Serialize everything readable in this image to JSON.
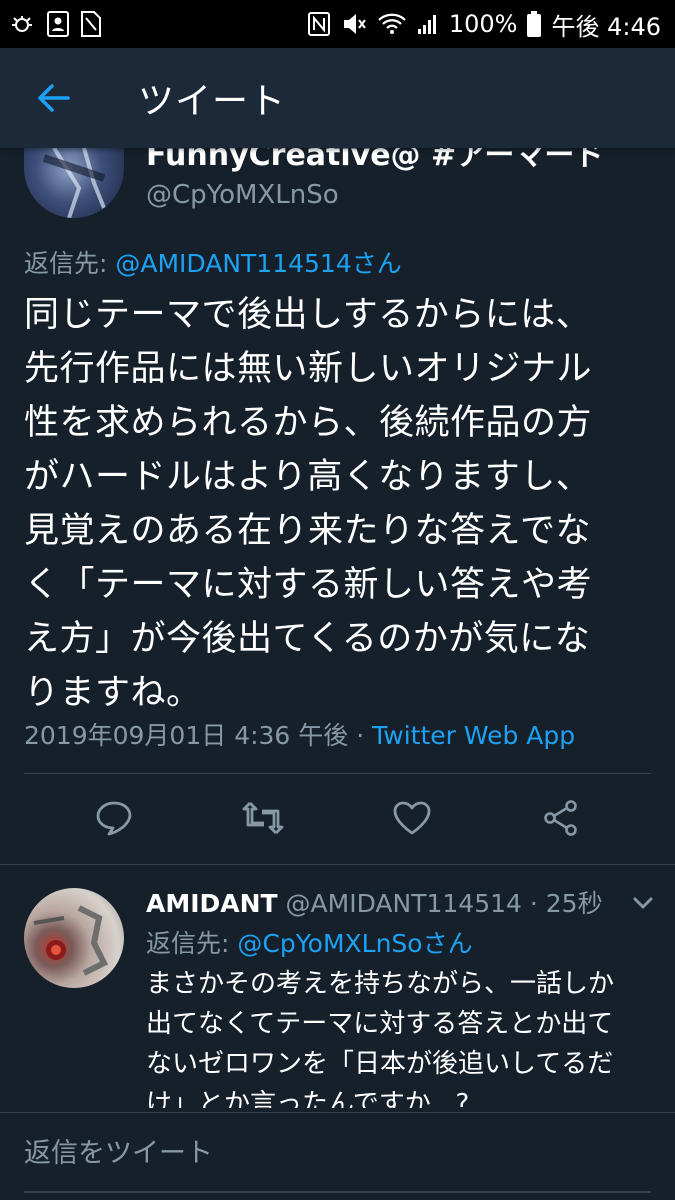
{
  "status_bar": {
    "battery": "100%",
    "time": "午後 4:46"
  },
  "header": {
    "title": "ツイート"
  },
  "main_tweet": {
    "display_name": "FunnyCreative@ #アーマードール…",
    "username": "@CpYoMXLnSo",
    "reply_prefix": "返信先: ",
    "reply_mention": "@AMIDANT114514さん",
    "text_lines": [
      "同じテーマで後出しするからには、",
      "先行作品には無い新しいオリジナル",
      "性を求められるから、後続作品の方",
      "がハードルはより高くなりますし、",
      "見覚えのある在り来たりな答えでな",
      "く「テーマに対する新しい答えや考",
      "え方」が今後出てくるのかが気にな",
      "りますね。"
    ],
    "timestamp": "2019年09月01日 4:36 午後",
    "separator": " · ",
    "source": "Twitter Web App"
  },
  "actions": [
    "reply-icon",
    "retweet-icon",
    "like-icon",
    "share-icon"
  ],
  "reply_tweet": {
    "display_name": "AMIDANT",
    "handle_time": " @AMIDANT114514 · 25秒",
    "reply_prefix": "返信先: ",
    "reply_mention": "@CpYoMXLnSoさん",
    "text_lines": [
      "まさかその考えを持ちながら、一話しか",
      "出てなくてテーマに対する答えとか出て",
      "ないゼロワンを「日本が後追いしてるだ",
      "け」とか言ったんですか...?"
    ]
  },
  "compose": {
    "placeholder": "返信をツイート"
  },
  "colors": {
    "background": "#15202b",
    "app_bar": "#1c2938",
    "accent": "#1da1f2",
    "secondary_text": "#8899a6",
    "divider": "#38444d"
  }
}
